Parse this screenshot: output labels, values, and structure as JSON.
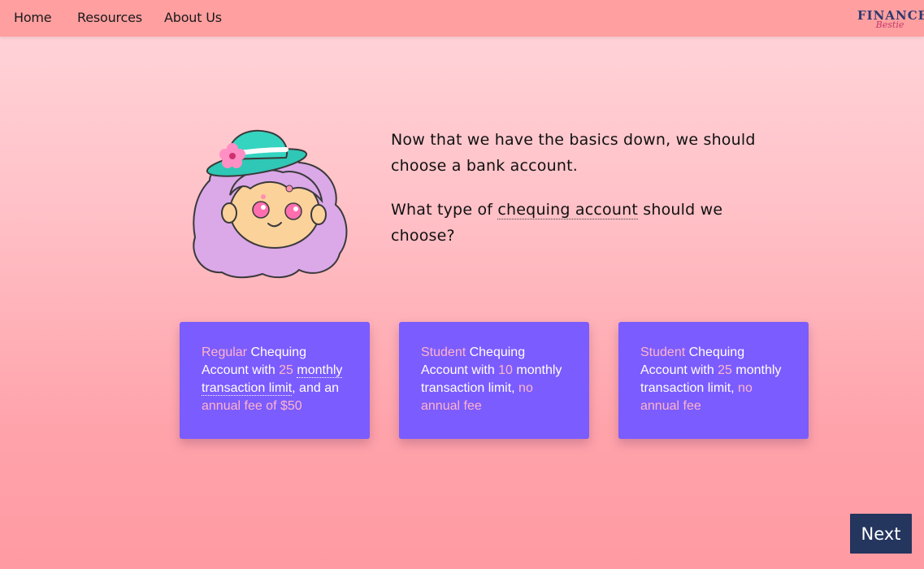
{
  "nav": {
    "home": "Home",
    "resources": "Resources",
    "about": "About Us"
  },
  "logo": {
    "main": "FINANCE",
    "sub": "Bestie"
  },
  "dialogue": {
    "line1": "Now that we have the basics down, we should choose a bank account.",
    "line2_pre": "What type of ",
    "line2_term": "chequing account",
    "line2_post": " should we choose?"
  },
  "cards": [
    {
      "type": "Regular",
      "t1": " Chequing Account with ",
      "limit": "25",
      "t2": " ",
      "limit_text": "monthly transaction limit",
      "t3": ", and an ",
      "fee": "annual fee of $50"
    },
    {
      "type": "Student",
      "t1": " Chequing Account with ",
      "limit": "10",
      "t2": " monthly transaction limit, ",
      "fee": "no annual fee"
    },
    {
      "type": "Student",
      "t1": " Chequing Account with ",
      "limit": "25",
      "t2": " monthly transaction limit, ",
      "fee": "no annual fee"
    }
  ],
  "next_label": "Next",
  "colors": {
    "nav_bg": "#ff9fa0",
    "card_bg": "#7b5cff",
    "highlight": "#ffb4c8",
    "button_bg": "#24355e"
  }
}
